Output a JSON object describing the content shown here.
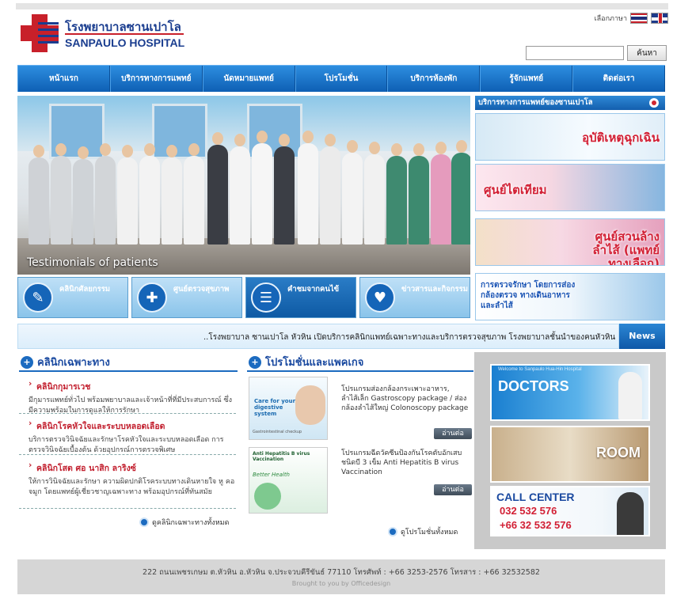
{
  "header": {
    "logo_th": "โรงพยาบาลซานเปาโล",
    "logo_en": "SANPAULO HOSPITAL",
    "language_label": "เลือกภาษา",
    "search_placeholder": "",
    "search_button": "ค้นหา"
  },
  "nav": {
    "items": [
      "หน้าแรก",
      "บริการทางการแพทย์",
      "นัดหมายแพทย์",
      "โปรโมชั่น",
      "บริการห้องพัก",
      "รู้จักแพทย์",
      "ติดต่อเรา"
    ]
  },
  "hero": {
    "caption": "Testimonials of patients",
    "tiles": [
      "คลินิกศัลยกรรม",
      "ศูนย์ตรวจสุขภาพ",
      "คำชมจากคนไข้",
      "ข่าวสารและกิจกรรม"
    ]
  },
  "services": {
    "heading": "บริการทางการแพทย์ของซานเปาโล",
    "banners": [
      "อุบัติเหตุฉุกเฉิน",
      "ศูนย์ไตเทียม",
      "ศูนย์สวนล้างลำไส้ (แพทย์ทางเลือก)",
      "การตรวจรักษา โดยการส่องกล้องตรวจ ทางเดินอาหารและลำไส้"
    ]
  },
  "ticker": {
    "text": "..โรงพยาบาล ซานเปาโล หัวหิน เปิดบริการคลินิกแพทย์เฉพาะทางและบริการตรวจสุขภาพ โรงพยาบาลชั้นนำของคนหัวหิน",
    "button": "News"
  },
  "clinics": {
    "title": "คลินิกเฉพาะทาง",
    "items": [
      {
        "name": "คลินิกกุมารเวช",
        "desc": "มีกุมารแพทย์ทั่วไป พร้อมพยาบาลและเจ้าหน้าที่ที่มีประสบการณ์ ซึ่งมีความพร้อมในการดูแลให้การรักษา"
      },
      {
        "name": "คลินิกโรคหัวใจและระบบหลอดเลือด",
        "desc": "บริการตรวจวินิจฉัยและรักษาโรคหัวใจและระบบหลอดเลือด การตรวจวินิจฉัยเบื้องต้น ด้วยอุปกรณ์การตรวจพิเศษ"
      },
      {
        "name": "คลินิกโสต ศอ นาสิก ลาริงซ์",
        "desc": "ให้การวินิจฉัยและรักษา ความผิดปกติโรคระบบทางเดินหายใจ หู คอ จมูก โดยแพทย์ผู้เชี่ยวชาญเฉพาะทาง พร้อมอุปกรณ์ที่ทันสมัย"
      }
    ],
    "more": "ดูคลินิกเฉพาะทางทั้งหมด"
  },
  "promos": {
    "title": "โปรโมชั่นและแพคเกจ",
    "items": [
      {
        "text": "โปรแกรมส่องกล้องกระเพาะอาหาร, ลำไส้เล็ก Gastroscopy package / ส่องกล้องลำไส้ใหญ่ Colonoscopy package",
        "image_caption": "Care for your digestive system",
        "image_sub": "Gastrointestinal checkup"
      },
      {
        "text": "โปรแกรมฉีดวัคซีนป้องกันโรคตับอักเสบ ชนิดบี 3 เข็ม Anti Hepatitis B virus Vaccination",
        "image_caption": "Anti Hepatitis B virus Vaccination",
        "image_sub": "Better Health"
      }
    ],
    "read_more": "อ่านต่อ",
    "more": "ดูโปรโมชั่นทั้งหมด"
  },
  "right_panel": {
    "cards": [
      {
        "label": "DOCTORS",
        "sub": "Welcome to Sanpaulo Hua-Hin Hospital"
      },
      {
        "label": "ROOM"
      },
      {
        "label": "CALL CENTER",
        "phone1": "032 532 576",
        "phone2": "+66 32 532 576"
      }
    ]
  },
  "footer": {
    "address": "222 ถนนเพชรเกษม ต.หัวหิน อ.หัวหิน จ.ประจวบคีรีขันธ์ 77110     โทรศัพท์ : +66 3253-2576 โทรสาร : +66 32532582",
    "credit": "Brought to you by Officedesign"
  },
  "colors": {
    "brand_blue": "#1c6bc0",
    "nav_blue": "#0e5fb4",
    "accent_red": "#c21f2e"
  }
}
